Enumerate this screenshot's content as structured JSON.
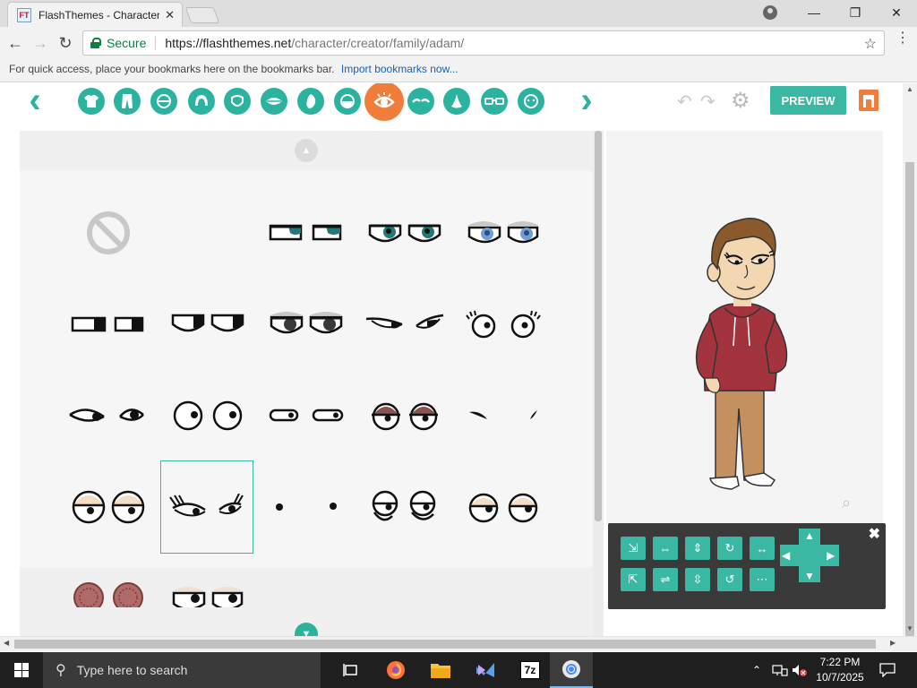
{
  "browser": {
    "tab_title": "FlashThemes - Character",
    "favicon_text": "FT",
    "url_secure_label": "Secure",
    "url_host": "https://flashthemes.net",
    "url_path": "/character/creator/family/adam/",
    "bookmarks_hint": "For quick access, place your bookmarks here on the bookmarks bar.",
    "bookmarks_import": "Import bookmarks now..."
  },
  "creator": {
    "categories": [
      "shirt-icon",
      "pants-icon",
      "body-icon",
      "hair-icon",
      "face-icon",
      "mouth-icon",
      "skin-icon",
      "beard-icon",
      "eyes-icon",
      "eyebrows-icon",
      "nose-icon",
      "glasses-icon",
      "accessory-icon"
    ],
    "active_category": "eyes-icon",
    "preview_label": "PREVIEW",
    "accent_color": "#3bb8a3",
    "active_color": "#f07d3a",
    "selected_eye_index": 16
  },
  "taskbar": {
    "search_placeholder": "Type here to search",
    "time": "7:22 PM",
    "date": "10/7/2025",
    "apps": [
      "task-view-icon",
      "firefox-icon",
      "file-explorer-icon",
      "visual-studio-icon",
      "7zip-icon",
      "chrome-icon"
    ],
    "app_7zip_label": "7z"
  }
}
